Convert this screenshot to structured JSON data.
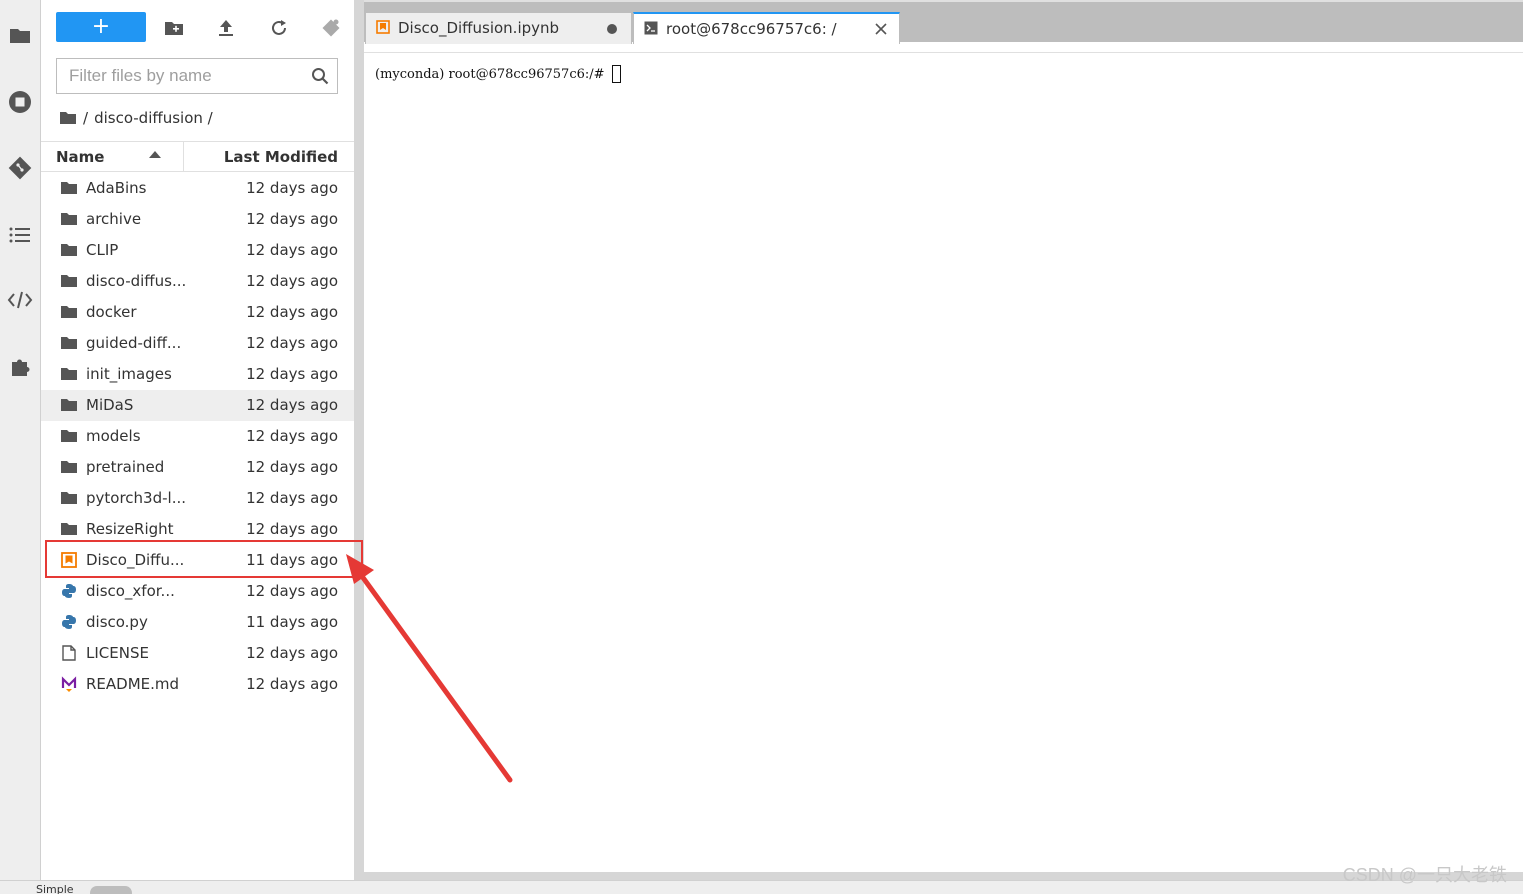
{
  "sidebar": {
    "icons": [
      "folder-icon",
      "running-icon",
      "git-icon",
      "toc-icon",
      "code-icon",
      "extensions-icon"
    ]
  },
  "file_browser": {
    "new_button_label": "+",
    "filter_placeholder": "Filter files by name",
    "breadcrumb": {
      "root": "/",
      "folder": "disco-diffusion /"
    },
    "columns": {
      "name": "Name",
      "last_modified": "Last Modified"
    },
    "files": [
      {
        "name": "AdaBins",
        "modified": "12 days ago",
        "kind": "folder"
      },
      {
        "name": "archive",
        "modified": "12 days ago",
        "kind": "folder"
      },
      {
        "name": "CLIP",
        "modified": "12 days ago",
        "kind": "folder"
      },
      {
        "name": "disco-diffus...",
        "modified": "12 days ago",
        "kind": "folder"
      },
      {
        "name": "docker",
        "modified": "12 days ago",
        "kind": "folder"
      },
      {
        "name": "guided-diff...",
        "modified": "12 days ago",
        "kind": "folder"
      },
      {
        "name": "init_images",
        "modified": "12 days ago",
        "kind": "folder"
      },
      {
        "name": "MiDaS",
        "modified": "12 days ago",
        "kind": "folder"
      },
      {
        "name": "models",
        "modified": "12 days ago",
        "kind": "folder"
      },
      {
        "name": "pretrained",
        "modified": "12 days ago",
        "kind": "folder"
      },
      {
        "name": "pytorch3d-l...",
        "modified": "12 days ago",
        "kind": "folder"
      },
      {
        "name": "ResizeRight",
        "modified": "12 days ago",
        "kind": "folder"
      },
      {
        "name": "Disco_Diffu...",
        "modified": "11 days ago",
        "kind": "notebook"
      },
      {
        "name": "disco_xfor...",
        "modified": "12 days ago",
        "kind": "python"
      },
      {
        "name": "disco.py",
        "modified": "11 days ago",
        "kind": "python"
      },
      {
        "name": "LICENSE",
        "modified": "12 days ago",
        "kind": "file"
      },
      {
        "name": "README.md",
        "modified": "12 days ago",
        "kind": "markdown"
      }
    ]
  },
  "tabs": [
    {
      "label": "Disco_Diffusion.ipynb",
      "icon": "notebook-icon"
    },
    {
      "label": "root@678cc96757c6: /",
      "icon": "terminal-icon"
    }
  ],
  "terminal": {
    "prompt": "(myconda) root@678cc96757c6:/#"
  },
  "status_bar": {
    "mode_label": "Simple"
  },
  "watermark": "CSDN @一只大老铁",
  "colors": {
    "accent": "#2196f3",
    "annotation": "#e53935",
    "notebook_icon": "#f57c00",
    "python_icon": "#3776ab",
    "markdown_icon": "#7b1fa2"
  }
}
